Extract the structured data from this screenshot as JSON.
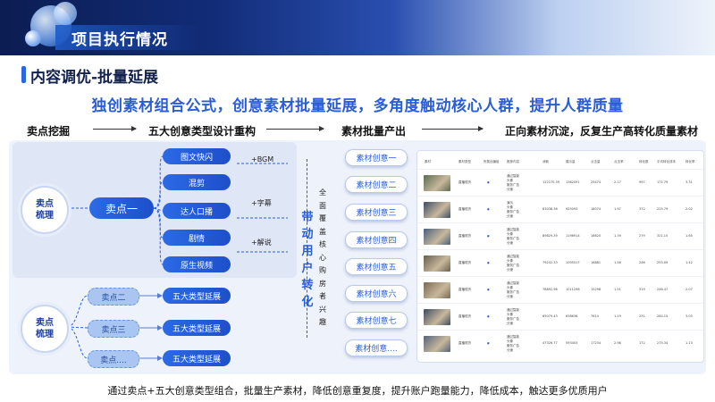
{
  "header": {
    "title": "项目执行情况"
  },
  "section": {
    "title": "内容调优-批量延展"
  },
  "headline": "独创素材组合公式，创意素材批量延展，多角度触动核心人群，提升人群质量",
  "steps": [
    "卖点挖掘",
    "五大创意类型设计重构",
    "素材批量产出",
    "正向素材沉淀，反复生产高转化质量素材"
  ],
  "top_flow": {
    "origin": "卖点梳理",
    "selling_point": "卖点一",
    "types": [
      "图文快闪",
      "混剪",
      "达人口播",
      "剧情",
      "原生视频"
    ],
    "additions": [
      "+BGM",
      "+字幕",
      "+解说"
    ]
  },
  "bottom_flow": {
    "origin": "卖点梳理",
    "rows": [
      {
        "point": "卖点二",
        "type": "五大类型延展"
      },
      {
        "point": "卖点三",
        "type": "五大类型延展"
      },
      {
        "point": "卖点....",
        "type": "五大类型延展"
      }
    ]
  },
  "vertical_label": "带动用户转化",
  "vertical_sub": "全面覆盖核心购房者兴趣",
  "materials": [
    "素材创意一",
    "素材创意二",
    "素材创意三",
    "素材创意四",
    "素材创意五",
    "素材创意六",
    "素材创意七",
    "素材创意...."
  ],
  "table": {
    "headers": [
      "素材",
      "素材类型",
      "所属创编组",
      "推荐内容",
      "消耗",
      "展示量",
      "点击量",
      "点击率",
      "转化数",
      "平均转化成本",
      "转化率"
    ],
    "rows": [
      {
        "type": "直播现货",
        "desc": "通过智能\n头像\n服务广告\n分速",
        "v": [
          "122270.39",
          "1362091",
          "29474",
          "2.17",
          "997",
          "171.79",
          "3.31"
        ]
      },
      {
        "type": "直播现货",
        "desc": "演示\n头像\n服务广告\n分速",
        "v": [
          "83038.36",
          "925093",
          "18074",
          "1.97",
          "372",
          "225.79",
          "2.02"
        ]
      },
      {
        "type": "直播现货",
        "desc": "通过智能\n头像\n服务广告\n分速",
        "v": [
          "89829.39",
          "1196914",
          "16620",
          "1.39",
          "279",
          "321.15",
          "1.65"
        ]
      },
      {
        "type": "直播现货",
        "desc": "通过智能\n头像\n服务广告\n分速",
        "v": [
          "79242.33",
          "1095517",
          "16881",
          "1.56",
          "246",
          "293.09",
          "1.42"
        ]
      },
      {
        "type": "直播现货",
        "desc": "通过智能\n头像\n服务广告\n分速",
        "v": [
          "78892.96",
          "1011298",
          "15298",
          "1.51",
          "319",
          "246.47",
          "2.07"
        ]
      },
      {
        "type": "直播现货",
        "desc": "通过智能\n头像\n服务广告\n分速",
        "v": [
          "65079.43",
          "638636",
          "7614",
          "1.19",
          "231",
          "284.15",
          "3.03"
        ]
      },
      {
        "type": "直播现货",
        "desc": "通过智能\n头像\n服务广告\n分速",
        "v": [
          "47326.77",
          "593403",
          "17234",
          "2.98",
          "172",
          "275.34",
          "1.13"
        ]
      }
    ]
  },
  "footer": "通过卖点+五大创意类型组合，批量生产素材，降低创意重复度，提升账户跑量能力，降低成本，触达更多优质用户"
}
